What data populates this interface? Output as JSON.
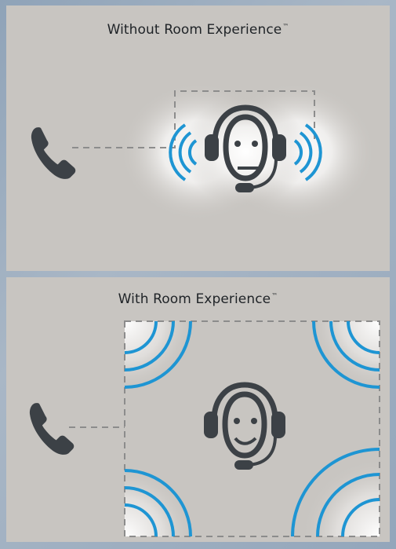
{
  "panels": [
    {
      "title": "Without Room Experience",
      "trademark": "™"
    },
    {
      "title": "With Room Experience",
      "trademark": "™"
    }
  ],
  "icons": {
    "phone": "phone-icon",
    "agent": "headset-agent-icon",
    "waves": "sound-wave-icon"
  },
  "colors": {
    "icon": "#3c4146",
    "wave": "#1e95d3",
    "dashed_line": "#8c8c8c",
    "panel_bg": "#c8c5c1"
  }
}
